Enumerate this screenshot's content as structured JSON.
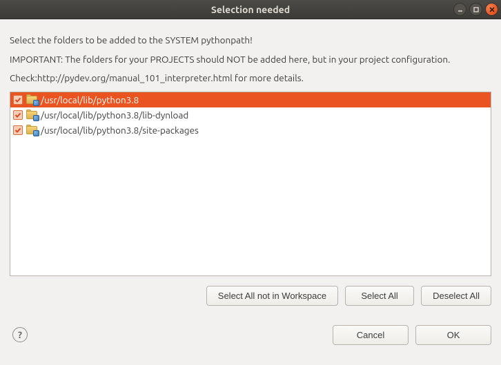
{
  "window": {
    "title": "Selection needed"
  },
  "messages": {
    "line1": "Select the folders to be added to the SYSTEM pythonpath!",
    "line2": "IMPORTANT: The folders for your PROJECTS should NOT be added here, but in your project configuration.",
    "line3": "Check:http://pydev.org/manual_101_interpreter.html for more details."
  },
  "items": [
    {
      "checked": true,
      "selected": true,
      "label": "/usr/local/lib/python3.8"
    },
    {
      "checked": true,
      "selected": false,
      "label": "/usr/local/lib/python3.8/lib-dynload"
    },
    {
      "checked": true,
      "selected": false,
      "label": "/usr/local/lib/python3.8/site-packages"
    }
  ],
  "buttons": {
    "select_not_workspace": "Select All not in Workspace",
    "select_all": "Select All",
    "deselect_all": "Deselect All",
    "cancel": "Cancel",
    "ok": "OK"
  }
}
